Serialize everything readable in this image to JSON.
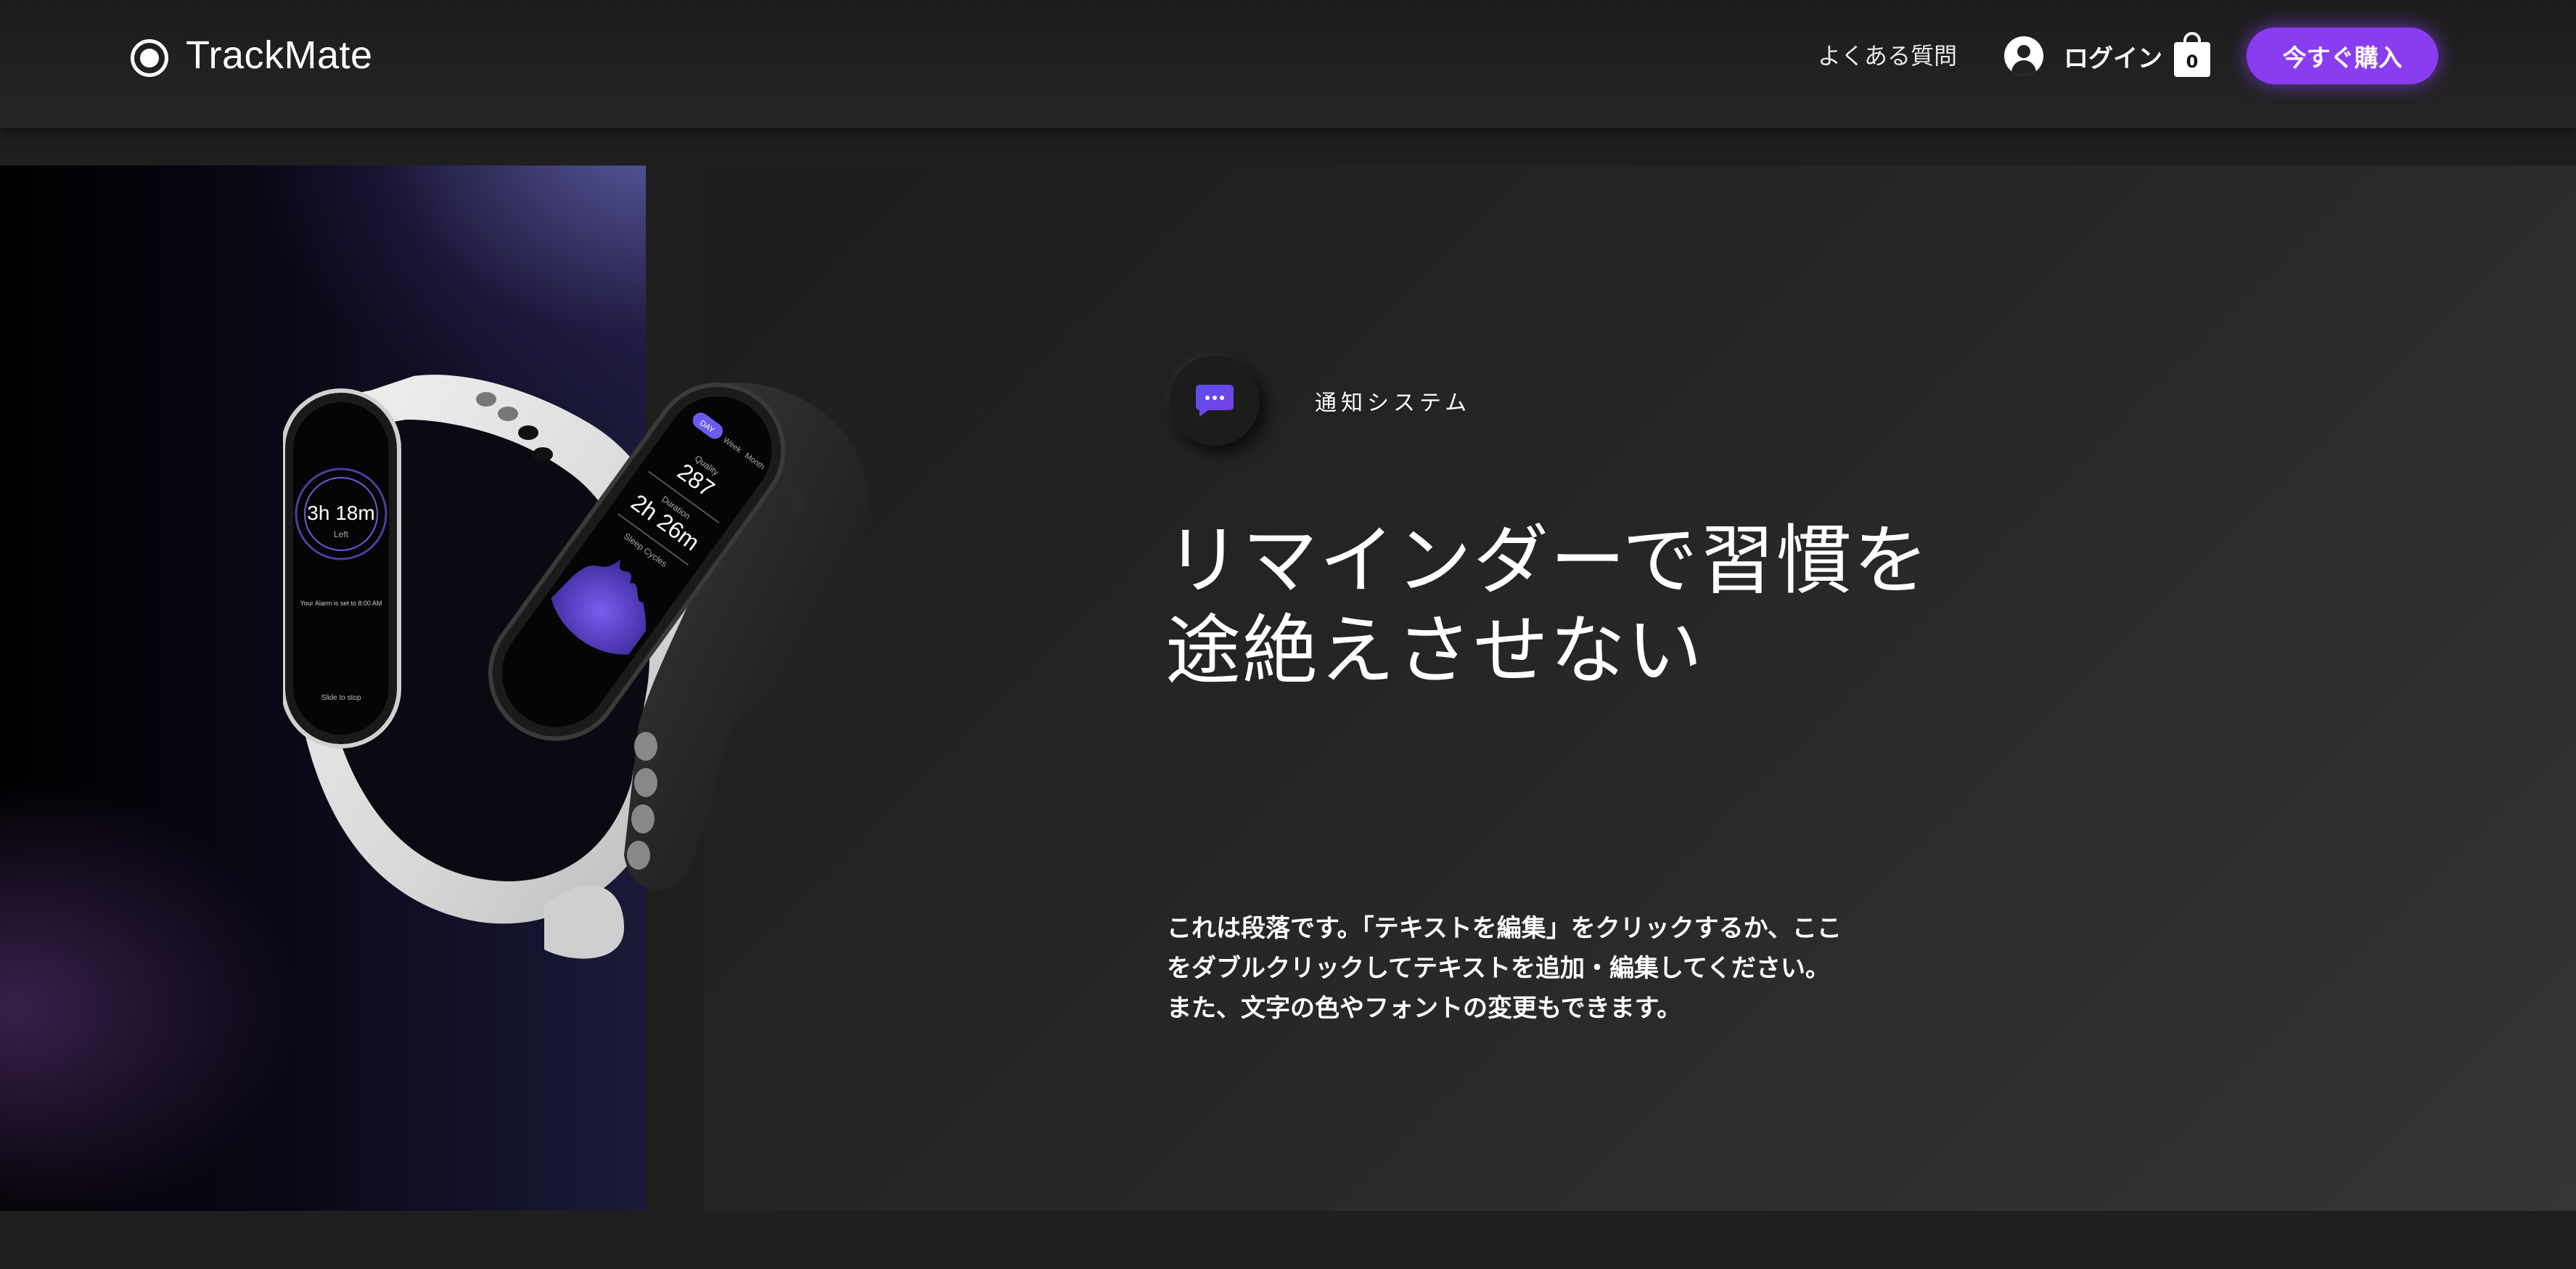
{
  "header": {
    "brand": "TrackMate",
    "nav_faq": "よくある質問",
    "login_label": "ログイン",
    "cart_count": "0",
    "buy_button": "今すぐ購入"
  },
  "hero": {
    "feature_label": "通知システム",
    "headline_line1": "リマインダーで習慣を",
    "headline_line2": "途絶えさせない",
    "paragraph": "これは段落です。「テキストを編集」をクリックするか、ここをダブルクリックしてテキストを追加・編集してください。また、文字の色やフォントの変更もできます。"
  },
  "watch_white": {
    "time": "3h 18m",
    "sub": "Left",
    "alarm_text": "Your Alarm is set to 8:00 AM",
    "slide_text": "Slide to stop"
  },
  "watch_black": {
    "pill": "DAY",
    "tabs": [
      "Week",
      "Month"
    ],
    "quality_label": "Quality",
    "quality_value": "287",
    "duration_label": "Duration",
    "duration_value": "2h 26m",
    "cycles_label": "Sleep Cycles"
  },
  "colors": {
    "accent": "#8a3df0",
    "chat_icon_gradient": [
      "#5a4ff0",
      "#7a3fe0"
    ]
  },
  "icons": {
    "logo": "target-ring-icon",
    "account": "user-circle-icon",
    "cart": "shopping-bag-icon",
    "feature": "chat-bubble-icon"
  }
}
